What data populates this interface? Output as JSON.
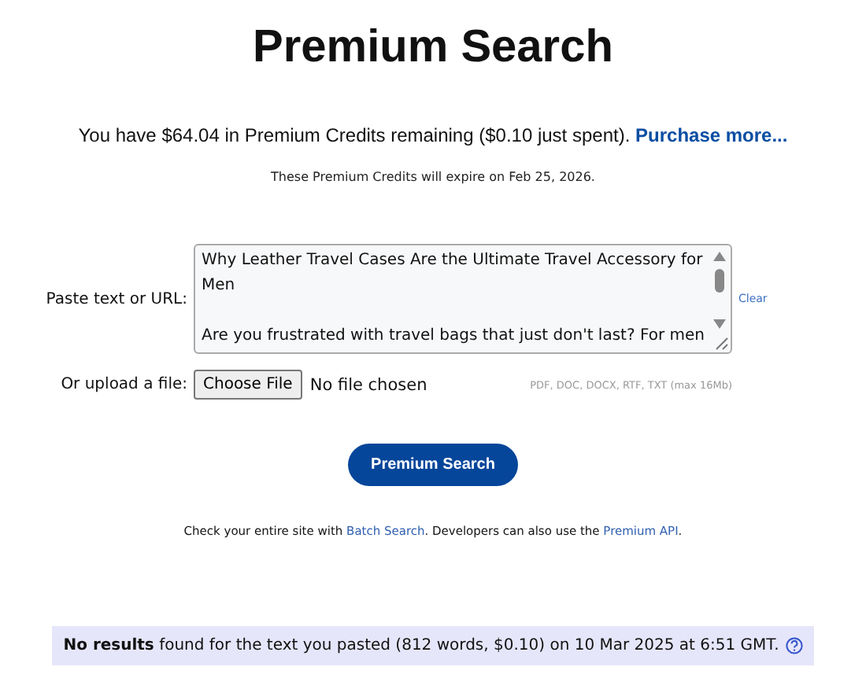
{
  "title": "Premium Search",
  "credits": {
    "text": "You have $64.04 in Premium Credits remaining ($0.10 just spent).",
    "link": "Purchase more..."
  },
  "expiry": "These Premium Credits will expire on Feb 25, 2026.",
  "paste": {
    "label": "Paste text or URL:",
    "paragraphs": [
      "Why Leather Travel Cases Are the Ultimate Travel Accessory for Men",
      "Are you frustrated with travel bags that just don't last? For men"
    ],
    "clear": "Clear"
  },
  "upload": {
    "label": "Or upload a file:",
    "button": "Choose File",
    "status": "No file chosen",
    "hint": "PDF, DOC, DOCX, RTF, TXT (max 16Mb)"
  },
  "submit": "Premium Search",
  "footer": [
    {
      "kind": "text",
      "text": "Check your entire site with "
    },
    {
      "kind": "link",
      "text": "Batch Search"
    },
    {
      "kind": "text",
      "text": ". Developers can also use the "
    },
    {
      "kind": "link",
      "text": "Premium API"
    },
    {
      "kind": "text",
      "text": "."
    }
  ],
  "result": "**No results** found for the text you pasted (812 words, $0.10) on 10 Mar 2025 at 6:51 GMT."
}
